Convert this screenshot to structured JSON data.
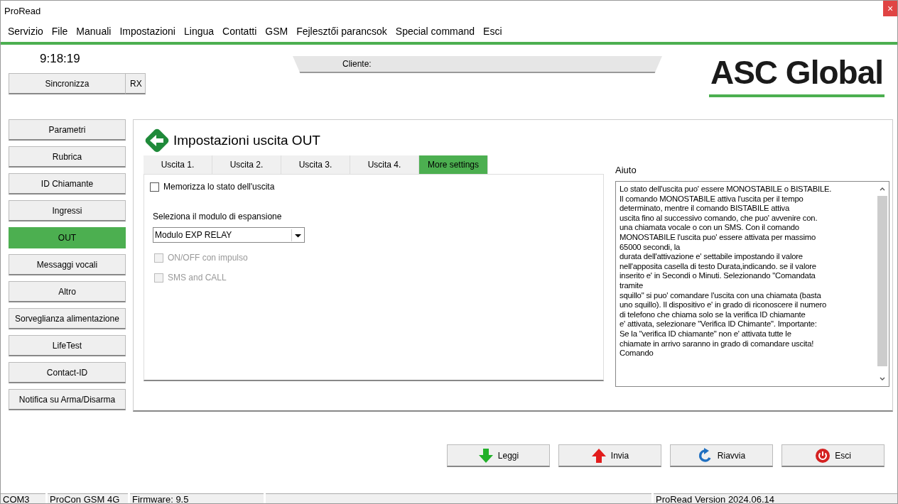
{
  "window": {
    "title": "ProRead",
    "close": "×"
  },
  "menu": [
    "Servizio",
    "File",
    "Manuali",
    "Impostazioni",
    "Lingua",
    "Contatti",
    "GSM",
    "Fejlesztői parancsok",
    "Special command",
    "Esci"
  ],
  "clock": "9:18:19",
  "sync_button": "Sincronizza",
  "rx_button": "RX",
  "client_label": "Cliente:",
  "logo": "ASC Global",
  "sidebar": [
    {
      "label": "Parametri",
      "selected": false
    },
    {
      "label": "Rubrica",
      "selected": false
    },
    {
      "label": "ID Chiamante",
      "selected": false
    },
    {
      "label": "Ingressi",
      "selected": false
    },
    {
      "label": "OUT",
      "selected": true
    },
    {
      "label": "Messaggi vocali",
      "selected": false
    },
    {
      "label": "Altro",
      "selected": false
    },
    {
      "label": "Sorveglianza alimentazione",
      "selected": false
    },
    {
      "label": "LifeTest",
      "selected": false
    },
    {
      "label": "Contact-ID",
      "selected": false
    },
    {
      "label": "Notifica su Arma/Disarma",
      "selected": false
    }
  ],
  "panel_title": "Impostazioni uscita OUT",
  "tabs": [
    {
      "label": "Uscita 1.",
      "selected": false
    },
    {
      "label": "Uscita 2.",
      "selected": false
    },
    {
      "label": "Uscita 3.",
      "selected": false
    },
    {
      "label": "Uscita 4.",
      "selected": false
    },
    {
      "label": "More settings",
      "selected": true
    }
  ],
  "memorize": {
    "label": "Memorizza lo stato dell'uscita",
    "checked": false,
    "disabled": false
  },
  "module_label": "Seleziona il modulo di espansione",
  "module_select": "Modulo EXP RELAY",
  "options": [
    {
      "label": "ON/OFF con impulso",
      "checked": false,
      "disabled": true
    },
    {
      "label": "SMS and CALL",
      "checked": false,
      "disabled": true
    }
  ],
  "help": {
    "title": "Aiuto",
    "text": "Lo stato dell'uscita puo' essere MONOSTABILE o BISTABILE.\nIl comando MONOSTABILE attiva l'uscita per il tempo\ndeterminato, mentre il comando BISTABILE attiva\nuscita fino al successivo comando, che puo' avvenire con.\nuna chiamata vocale o con un SMS.  Con il comando\nMONOSTABILE l'uscita puo' essere attivata per massimo\n65000 secondi, la\ndurata dell'attivazione e' settabile impostando il valore\nnell'apposita casella di testo Durata,indicando.  se il valore\ninserito e' in Secondi o Minuti. Selezionando \"Comandata\ntramite\nsquillo\" si puo' comandare l'uscita con una chiamata (basta\nuno squillo).  Il dispositivo e' in grado di riconoscere il numero\ndi telefono che chiama solo se la verifica ID chiamante\ne' attivata, selezionare \"Verifica ID Chimante\".  Importante:\nSe la \"verifica ID chiamante\" non e' attivata tutte le\nchiamate in arrivo saranno in grado di comandare uscita!\nComando"
  },
  "actions": [
    {
      "label": "Leggi",
      "kind": "read"
    },
    {
      "label": "Invia",
      "kind": "send"
    },
    {
      "label": "Riavvia",
      "kind": "restart"
    },
    {
      "label": "Esci",
      "kind": "exit"
    }
  ],
  "status_bar": [
    "COM3",
    "ProCon GSM 4G",
    "Firmware: 9.5",
    "ProRead Version 2024.06.14"
  ]
}
